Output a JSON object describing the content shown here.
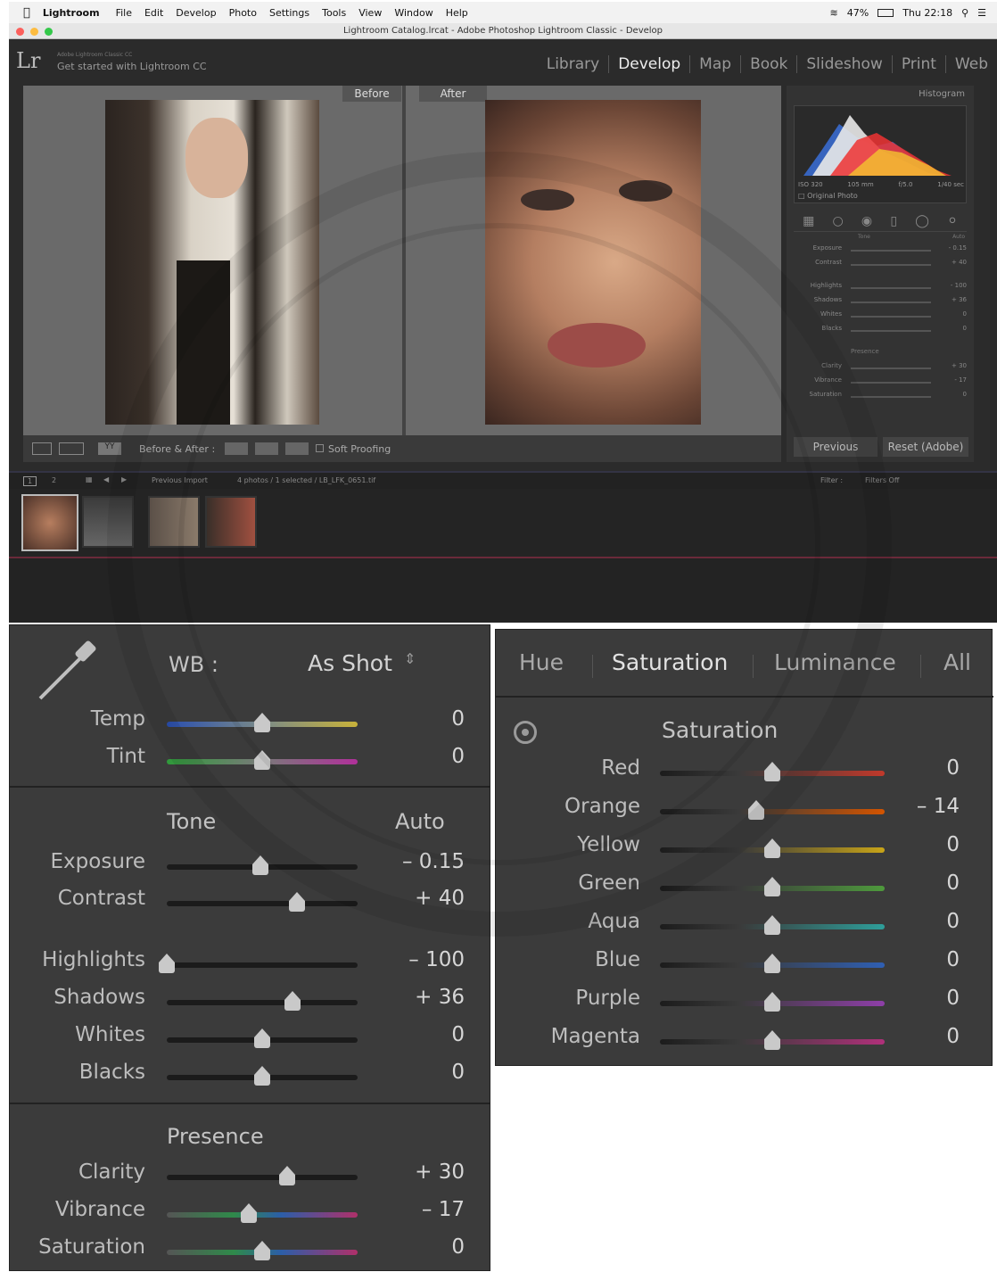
{
  "menubar": {
    "app": "Lightroom",
    "items": [
      "File",
      "Edit",
      "Develop",
      "Photo",
      "Settings",
      "Tools",
      "View",
      "Window",
      "Help"
    ],
    "battery": "47%",
    "clock": "Thu 22:18"
  },
  "window": {
    "title": "Lightroom Catalog.lrcat - Adobe Photoshop Lightroom Classic - Develop"
  },
  "identity": {
    "logo": "Lr",
    "small": "Adobe Lightroom Classic CC",
    "get_started": "Get started with Lightroom CC"
  },
  "modules": {
    "items": [
      "Library",
      "Develop",
      "Map",
      "Book",
      "Slideshow",
      "Print",
      "Web"
    ],
    "active": "Develop"
  },
  "view": {
    "before_label": "Before",
    "after_label": "After",
    "ba_toggle": "Before & After :",
    "soft_proofing": "Soft Proofing"
  },
  "right_panel": {
    "histogram_label": "Histogram",
    "iso": "ISO 320",
    "focal": "105 mm",
    "aperture": "f/5.0",
    "shutter": "1/40 sec",
    "original_photo": "Original Photo",
    "tone_label": "Tone",
    "auto_label": "Auto",
    "presence_label": "Presence",
    "small_rows": [
      {
        "label": "Exposure",
        "value": "- 0.15"
      },
      {
        "label": "Contrast",
        "value": "+ 40"
      },
      {
        "label": "Highlights",
        "value": "- 100"
      },
      {
        "label": "Shadows",
        "value": "+ 36"
      },
      {
        "label": "Whites",
        "value": "0"
      },
      {
        "label": "Blacks",
        "value": "0"
      },
      {
        "label": "Clarity",
        "value": "+ 30"
      },
      {
        "label": "Vibrance",
        "value": "- 17"
      },
      {
        "label": "Saturation",
        "value": "0"
      }
    ],
    "previous_button": "Previous",
    "reset_button": "Reset (Adobe)"
  },
  "filmstrip_bar": {
    "page1": "1",
    "page2": "2",
    "source": "Previous Import",
    "count": "4 photos / 1 selected / LB_LFK_0651.tif",
    "filter": "Filter :",
    "filters_off": "Filters Off"
  },
  "basic": {
    "wb_label": "WB :",
    "wb_value": "As Shot",
    "tone_label": "Tone",
    "auto_label": "Auto",
    "presence_label": "Presence",
    "sliders": [
      {
        "label": "Temp",
        "value": "0",
        "level": 0.5
      },
      {
        "label": "Tint",
        "value": "0",
        "level": 0.5
      },
      {
        "label": "Exposure",
        "value": "– 0.15",
        "level": 0.49
      },
      {
        "label": "Contrast",
        "value": "+ 40",
        "level": 0.68
      },
      {
        "label": "Highlights",
        "value": "– 100",
        "level": 0.0
      },
      {
        "label": "Shadows",
        "value": "+ 36",
        "level": 0.66
      },
      {
        "label": "Whites",
        "value": "0",
        "level": 0.5
      },
      {
        "label": "Blacks",
        "value": "0",
        "level": 0.5
      },
      {
        "label": "Clarity",
        "value": "+ 30",
        "level": 0.63
      },
      {
        "label": "Vibrance",
        "value": "– 17",
        "level": 0.43
      },
      {
        "label": "Saturation",
        "value": "0",
        "level": 0.5
      }
    ]
  },
  "hsl": {
    "tabs": [
      "Hue",
      "Saturation",
      "Luminance",
      "All"
    ],
    "active_tab": "Saturation",
    "section_title": "Saturation",
    "sliders": [
      {
        "label": "Red",
        "value": "0",
        "level": 0.5,
        "color": "#c0392b"
      },
      {
        "label": "Orange",
        "value": "– 14",
        "level": 0.43,
        "color": "#d35400"
      },
      {
        "label": "Yellow",
        "value": "0",
        "level": 0.5,
        "color": "#c8a418"
      },
      {
        "label": "Green",
        "value": "0",
        "level": 0.5,
        "color": "#4e9a3c"
      },
      {
        "label": "Aqua",
        "value": "0",
        "level": 0.5,
        "color": "#2e9e9a"
      },
      {
        "label": "Blue",
        "value": "0",
        "level": 0.5,
        "color": "#2f5fb3"
      },
      {
        "label": "Purple",
        "value": "0",
        "level": 0.5,
        "color": "#8e3fa8"
      },
      {
        "label": "Magenta",
        "value": "0",
        "level": 0.5,
        "color": "#b0307a"
      }
    ]
  },
  "colors": {
    "panel": "#3b3b3b",
    "lr_bg": "#2b2b2b",
    "text_label": "#bdbdbd",
    "text_value": "#d6d6d6"
  }
}
